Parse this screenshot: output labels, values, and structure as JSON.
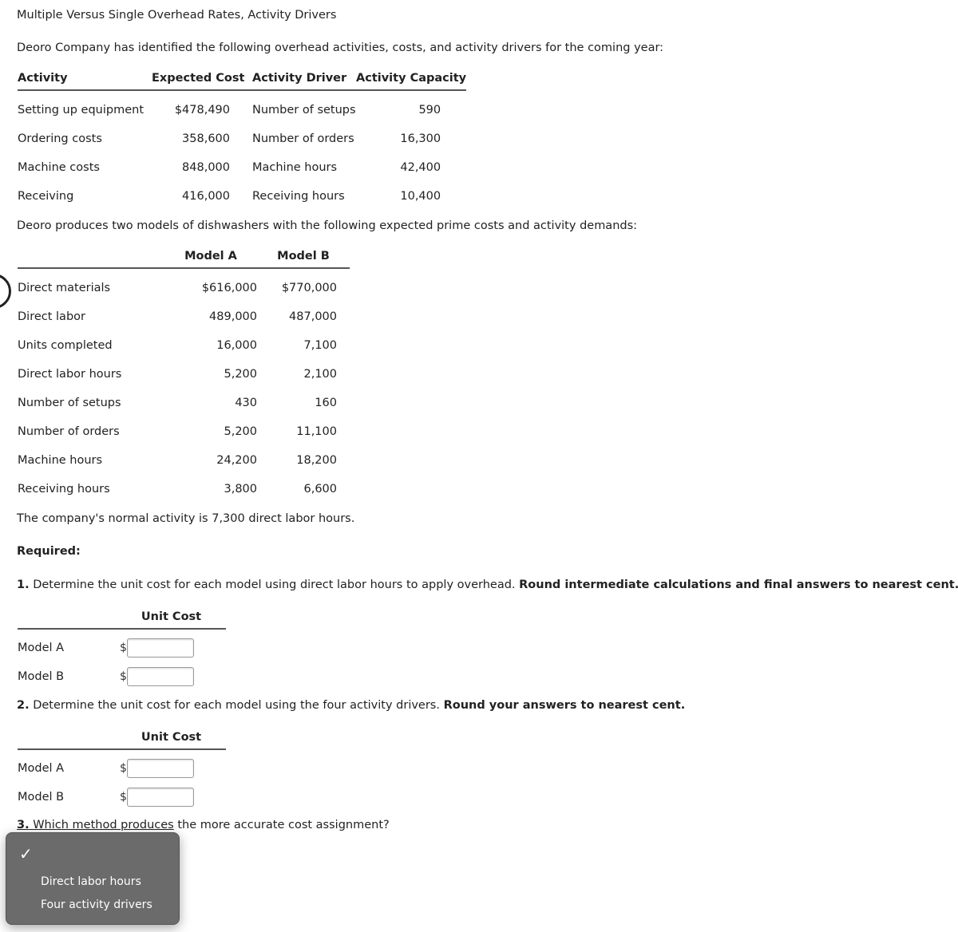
{
  "title": "Multiple Versus Single Overhead Rates, Activity Drivers",
  "intro": "Deoro Company has identified the following overhead activities, costs, and activity drivers for the coming year:",
  "activities_table": {
    "headers": [
      "Activity",
      "Expected Cost",
      "Activity Driver",
      "Activity Capacity"
    ],
    "rows": [
      [
        "Setting up equipment",
        "$478,490",
        "Number of setups",
        "590"
      ],
      [
        "Ordering costs",
        "358,600",
        "Number of orders",
        "16,300"
      ],
      [
        "Machine costs",
        "848,000",
        "Machine hours",
        "42,400"
      ],
      [
        "Receiving",
        "416,000",
        "Receiving hours",
        "10,400"
      ]
    ]
  },
  "models_intro": "Deoro produces two models of dishwashers with the following expected prime costs and activity demands:",
  "models_table": {
    "headers": [
      "",
      "Model A",
      "Model B"
    ],
    "rows": [
      [
        "Direct materials",
        "$616,000",
        "$770,000"
      ],
      [
        "Direct labor",
        "489,000",
        "487,000"
      ],
      [
        "Units completed",
        "16,000",
        "7,100"
      ],
      [
        "Direct labor hours",
        "5,200",
        "2,100"
      ],
      [
        "Number of setups",
        "430",
        "160"
      ],
      [
        "Number of orders",
        "5,200",
        "11,100"
      ],
      [
        "Machine hours",
        "24,200",
        "18,200"
      ],
      [
        "Receiving hours",
        "3,800",
        "6,600"
      ]
    ]
  },
  "normal_activity": "The company's normal activity is 7,300 direct labor hours.",
  "required_label": "Required:",
  "q1": {
    "number": "1.",
    "text": " Determine the unit cost for each model using direct labor hours to apply overhead. ",
    "bold": "Round intermediate calculations and final answers to nearest cent.",
    "column_header": "Unit Cost",
    "rows": [
      {
        "label": "Model A",
        "currency": "$",
        "value": ""
      },
      {
        "label": "Model B",
        "currency": "$",
        "value": ""
      }
    ]
  },
  "q2": {
    "number": "2.",
    "text": " Determine the unit cost for each model using the four activity drivers. ",
    "bold": "Round your answers to nearest cent.",
    "column_header": "Unit Cost",
    "rows": [
      {
        "label": "Model A",
        "currency": "$",
        "value": ""
      },
      {
        "label": "Model B",
        "currency": "$",
        "value": ""
      }
    ]
  },
  "q3": {
    "number": "3.",
    "text_underlined": " Which method produces",
    "text_rest": " the more accurate cost assignment?",
    "dropdown": {
      "selected": "",
      "checkmark": "✓",
      "options": [
        "Direct labor hours",
        "Four activity drivers"
      ]
    }
  }
}
